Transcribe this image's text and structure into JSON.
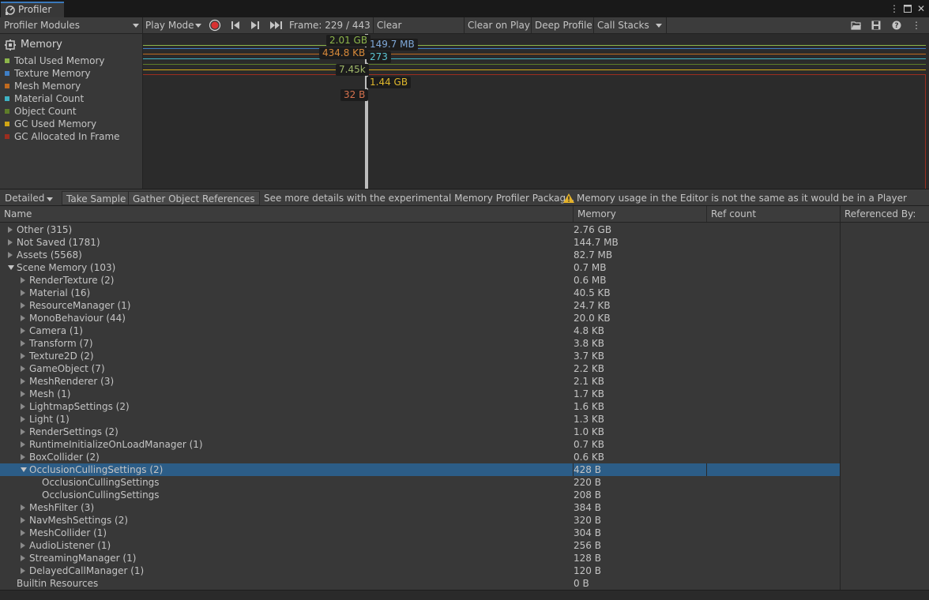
{
  "window": {
    "tab_title": "Profiler"
  },
  "toolbar": {
    "modules_label": "Profiler Modules",
    "play_mode_label": "Play Mode",
    "frame_label": "Frame: 229 / 443",
    "clear_label": "Clear",
    "clear_on_play_label": "Clear on Play",
    "deep_profile_label": "Deep Profile",
    "call_stacks_label": "Call Stacks"
  },
  "module": {
    "title": "Memory",
    "legend": [
      {
        "label": "Total Used Memory",
        "color": "#8db64b"
      },
      {
        "label": "Texture Memory",
        "color": "#3f7fc6"
      },
      {
        "label": "Mesh Memory",
        "color": "#c06a1f"
      },
      {
        "label": "Material Count",
        "color": "#3fb3c4"
      },
      {
        "label": "Object Count",
        "color": "#5e7d2a"
      },
      {
        "label": "GC Used Memory",
        "color": "#d1a515"
      },
      {
        "label": "GC Allocated In Frame",
        "color": "#9b2d1f"
      }
    ]
  },
  "graph_labels": {
    "total_used": "2.01 GB",
    "texture": "149.7 MB",
    "mesh": "434.8 KB",
    "material_count": "273",
    "object_count": "7.45k",
    "gc_used": "1.44 GB",
    "gc_alloc": "32 B"
  },
  "detail_toolbar": {
    "view_mode": "Detailed",
    "take_sample": "Take Sample",
    "gather_refs": "Gather Object References",
    "info_text": "See more details with the experimental Memory Profiler Package.",
    "warning_text": "Memory usage in the Editor is not the same as it would be in a Player"
  },
  "table": {
    "columns": {
      "name": "Name",
      "memory": "Memory",
      "ref_count": "Ref count",
      "referenced_by": "Referenced By:"
    },
    "rows": [
      {
        "name": "Other (315)",
        "memory": "2.76 GB",
        "level": 0,
        "arrow": "right"
      },
      {
        "name": "Not Saved (1781)",
        "memory": "144.7 MB",
        "level": 0,
        "arrow": "right"
      },
      {
        "name": "Assets (5568)",
        "memory": "82.7 MB",
        "level": 0,
        "arrow": "right"
      },
      {
        "name": "Scene Memory (103)",
        "memory": "0.7 MB",
        "level": 0,
        "arrow": "down"
      },
      {
        "name": "RenderTexture (2)",
        "memory": "0.6 MB",
        "level": 1,
        "arrow": "right"
      },
      {
        "name": "Material (16)",
        "memory": "40.5 KB",
        "level": 1,
        "arrow": "right"
      },
      {
        "name": "ResourceManager (1)",
        "memory": "24.7 KB",
        "level": 1,
        "arrow": "right"
      },
      {
        "name": "MonoBehaviour (44)",
        "memory": "20.0 KB",
        "level": 1,
        "arrow": "right"
      },
      {
        "name": "Camera (1)",
        "memory": "4.8 KB",
        "level": 1,
        "arrow": "right"
      },
      {
        "name": "Transform (7)",
        "memory": "3.8 KB",
        "level": 1,
        "arrow": "right"
      },
      {
        "name": "Texture2D (2)",
        "memory": "3.7 KB",
        "level": 1,
        "arrow": "right"
      },
      {
        "name": "GameObject (7)",
        "memory": "2.2 KB",
        "level": 1,
        "arrow": "right"
      },
      {
        "name": "MeshRenderer (3)",
        "memory": "2.1 KB",
        "level": 1,
        "arrow": "right"
      },
      {
        "name": "Mesh (1)",
        "memory": "1.7 KB",
        "level": 1,
        "arrow": "right"
      },
      {
        "name": "LightmapSettings (2)",
        "memory": "1.6 KB",
        "level": 1,
        "arrow": "right"
      },
      {
        "name": "Light (1)",
        "memory": "1.3 KB",
        "level": 1,
        "arrow": "right"
      },
      {
        "name": "RenderSettings (2)",
        "memory": "1.0 KB",
        "level": 1,
        "arrow": "right"
      },
      {
        "name": "RuntimeInitializeOnLoadManager (1)",
        "memory": "0.7 KB",
        "level": 1,
        "arrow": "right"
      },
      {
        "name": "BoxCollider (2)",
        "memory": "0.6 KB",
        "level": 1,
        "arrow": "right"
      },
      {
        "name": "OcclusionCullingSettings (2)",
        "memory": "428 B",
        "level": 1,
        "arrow": "down",
        "selected": true
      },
      {
        "name": "OcclusionCullingSettings",
        "memory": "220 B",
        "level": 2,
        "arrow": "none"
      },
      {
        "name": "OcclusionCullingSettings",
        "memory": "208 B",
        "level": 2,
        "arrow": "none"
      },
      {
        "name": "MeshFilter (3)",
        "memory": "384 B",
        "level": 1,
        "arrow": "right"
      },
      {
        "name": "NavMeshSettings (2)",
        "memory": "320 B",
        "level": 1,
        "arrow": "right"
      },
      {
        "name": "MeshCollider (1)",
        "memory": "304 B",
        "level": 1,
        "arrow": "right"
      },
      {
        "name": "AudioListener (1)",
        "memory": "256 B",
        "level": 1,
        "arrow": "right"
      },
      {
        "name": "StreamingManager (1)",
        "memory": "128 B",
        "level": 1,
        "arrow": "right"
      },
      {
        "name": "DelayedCallManager (1)",
        "memory": "120 B",
        "level": 1,
        "arrow": "right"
      },
      {
        "name": "Builtin Resources",
        "memory": "0 B",
        "level": 0,
        "arrow": "none"
      }
    ]
  }
}
